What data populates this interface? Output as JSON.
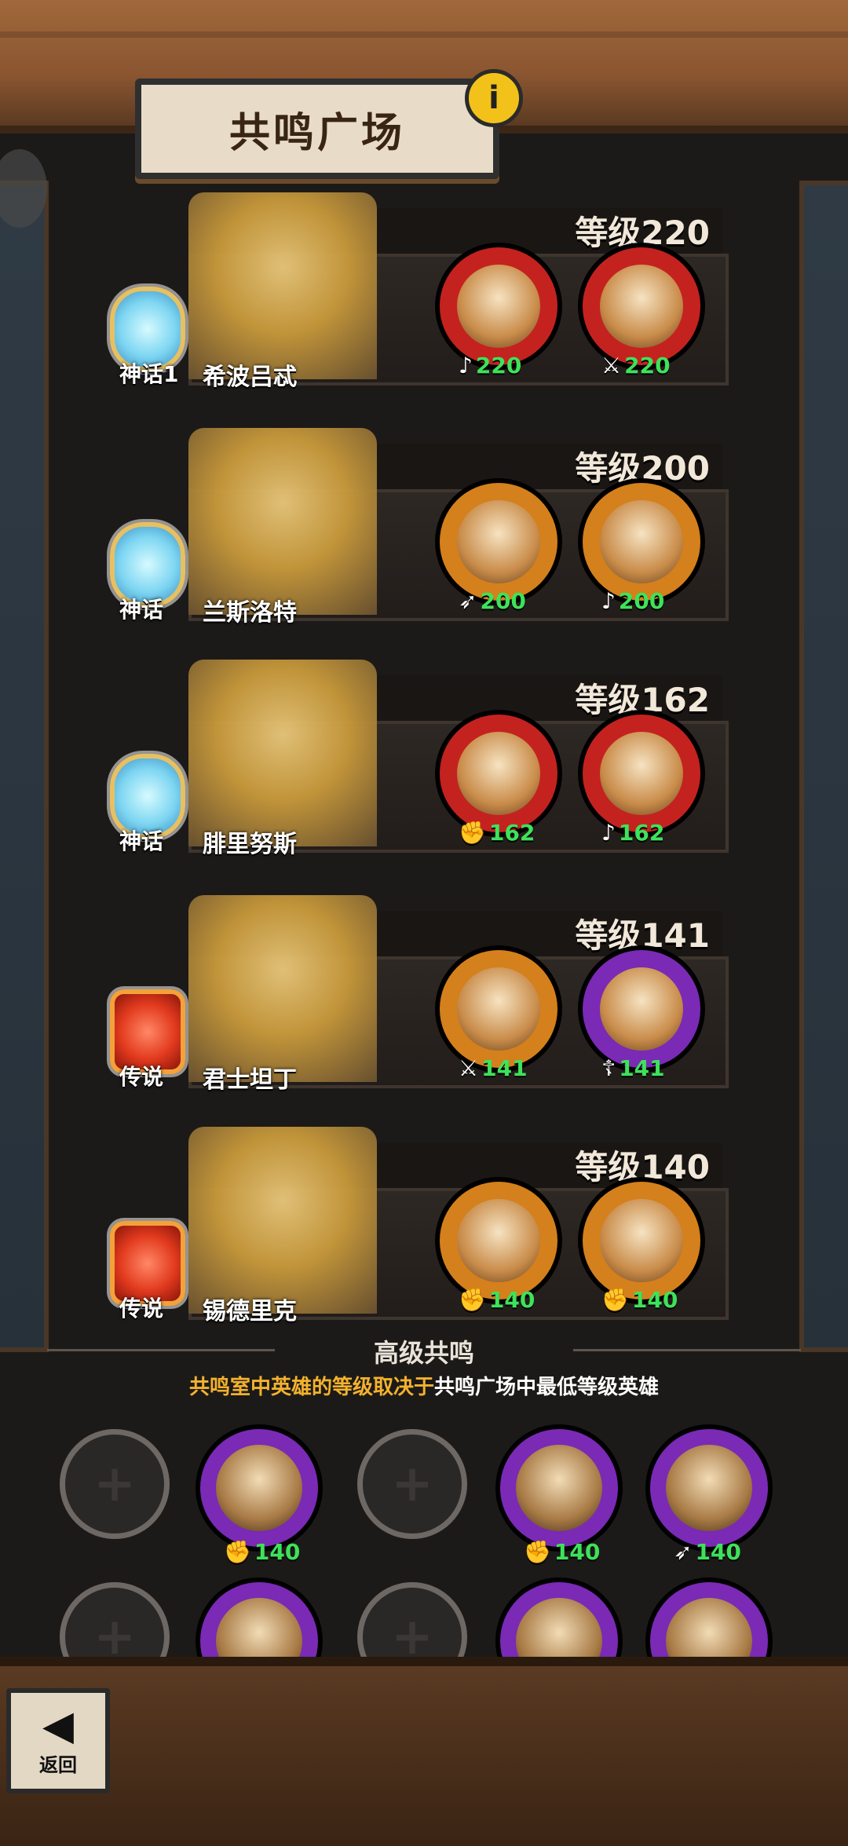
{
  "header": {
    "title": "共鸣广场",
    "info_icon": "i"
  },
  "heroes": [
    {
      "level_label": "等级220",
      "rank": "神话1",
      "rank_type": "myth",
      "name": "希波吕忒",
      "companions": [
        {
          "class_icon": "lyre-icon",
          "class_glyph": "♪",
          "level": "220",
          "ring": "red"
        },
        {
          "class_icon": "sword-icon",
          "class_glyph": "⚔",
          "level": "220",
          "ring": "red"
        }
      ]
    },
    {
      "level_label": "等级200",
      "rank": "神话",
      "rank_type": "myth",
      "name": "兰斯洛特",
      "companions": [
        {
          "class_icon": "bow-icon",
          "class_glyph": "➶",
          "level": "200",
          "ring": "orange"
        },
        {
          "class_icon": "lyre-icon",
          "class_glyph": "♪",
          "level": "200",
          "ring": "orange"
        }
      ]
    },
    {
      "level_label": "等级162",
      "rank": "神话",
      "rank_type": "myth",
      "name": "腓里努斯",
      "companions": [
        {
          "class_icon": "fist-icon",
          "class_glyph": "✊",
          "level": "162",
          "ring": "red"
        },
        {
          "class_icon": "lyre-icon",
          "class_glyph": "♪",
          "level": "162",
          "ring": "red"
        }
      ]
    },
    {
      "level_label": "等级141",
      "rank": "传说",
      "rank_type": "legend",
      "name": "君士坦丁",
      "companions": [
        {
          "class_icon": "sword-icon",
          "class_glyph": "⚔",
          "level": "141",
          "ring": "orange"
        },
        {
          "class_icon": "staff-icon",
          "class_glyph": "☦",
          "level": "141",
          "ring": "purple"
        }
      ]
    },
    {
      "level_label": "等级140",
      "rank": "传说",
      "rank_type": "legend",
      "name": "锡德里克",
      "companions": [
        {
          "class_icon": "fist-icon",
          "class_glyph": "✊",
          "level": "140",
          "ring": "orange"
        },
        {
          "class_icon": "fist-icon",
          "class_glyph": "✊",
          "level": "140",
          "ring": "orange"
        }
      ]
    }
  ],
  "advanced": {
    "title": "高级共鸣",
    "subtitle_part1": "共鸣室中英雄的等级取决于",
    "subtitle_part2": "共鸣广场中最低等级英雄",
    "slots_row1": [
      {
        "type": "empty"
      },
      {
        "type": "hero",
        "class_glyph": "✊",
        "level": "140"
      },
      {
        "type": "empty"
      },
      {
        "type": "hero",
        "class_glyph": "✊",
        "level": "140"
      },
      {
        "type": "hero",
        "class_glyph": "➶",
        "level": "140"
      }
    ],
    "slots_row2": [
      {
        "type": "empty"
      },
      {
        "type": "hero"
      },
      {
        "type": "empty"
      },
      {
        "type": "hero"
      },
      {
        "type": "hero"
      }
    ]
  },
  "footer": {
    "back_label": "返回",
    "back_icon": "◀"
  }
}
